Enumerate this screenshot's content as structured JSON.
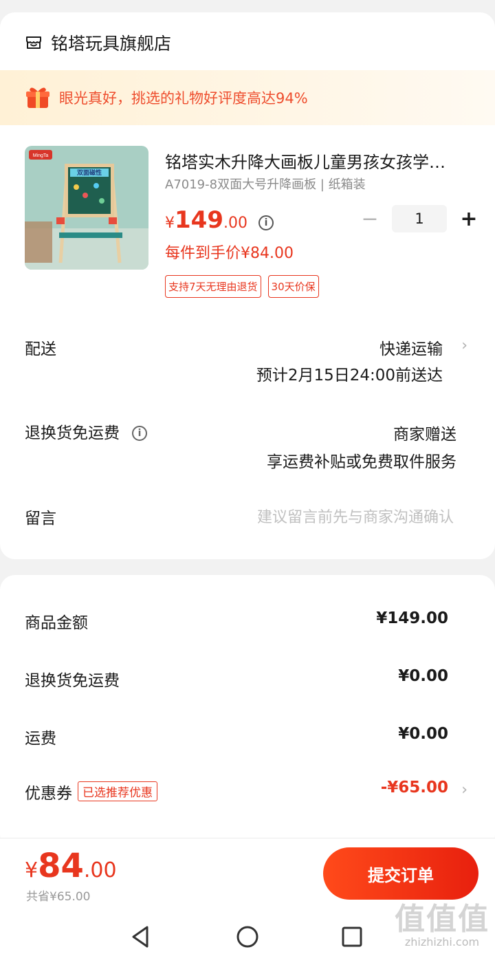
{
  "shop": {
    "name": "铭塔玩具旗舰店"
  },
  "banner": {
    "text": "眼光真好，挑选的礼物好评度高达94%"
  },
  "product": {
    "image_brand": "MingTa",
    "image_board_text": "双面磁性",
    "title": "铭塔实木升降大画板儿童男孩女孩学…",
    "spec": "A7019-8双面大号升降画板 | 纸箱装",
    "price_symbol": "¥",
    "price_int": "149",
    "price_dec": ".00",
    "unit_price": "每件到手价¥84.00",
    "tags": [
      "支持7天无理由退货",
      "30天价保"
    ],
    "quantity": "1"
  },
  "delivery": {
    "label": "配送",
    "method": "快递运输",
    "eta": "预计2月15日24:00前送达"
  },
  "return_shipping": {
    "label": "退换货免运费",
    "value": "商家赠送",
    "desc": "享运费补贴或免费取件服务"
  },
  "message": {
    "label": "留言",
    "placeholder": "建议留言前先与商家沟通确认"
  },
  "summary": {
    "goods_label": "商品金额",
    "goods_value": "¥149.00",
    "return_label": "退换货免运费",
    "return_value": "¥0.00",
    "shipping_label": "运费",
    "shipping_value": "¥0.00",
    "coupon_label": "优惠券",
    "coupon_badge": "已选推荐优惠",
    "coupon_value": "-¥65.00"
  },
  "footer": {
    "total_symbol": "¥",
    "total_int": "84",
    "total_dec": ".00",
    "saved": "共省¥65.00",
    "submit_label": "提交订单"
  },
  "watermark": {
    "logo": "值值值",
    "url": "zhizhizhi.com"
  },
  "colors": {
    "accent": "#e8361e",
    "banner_bg": "#fff1d6"
  }
}
